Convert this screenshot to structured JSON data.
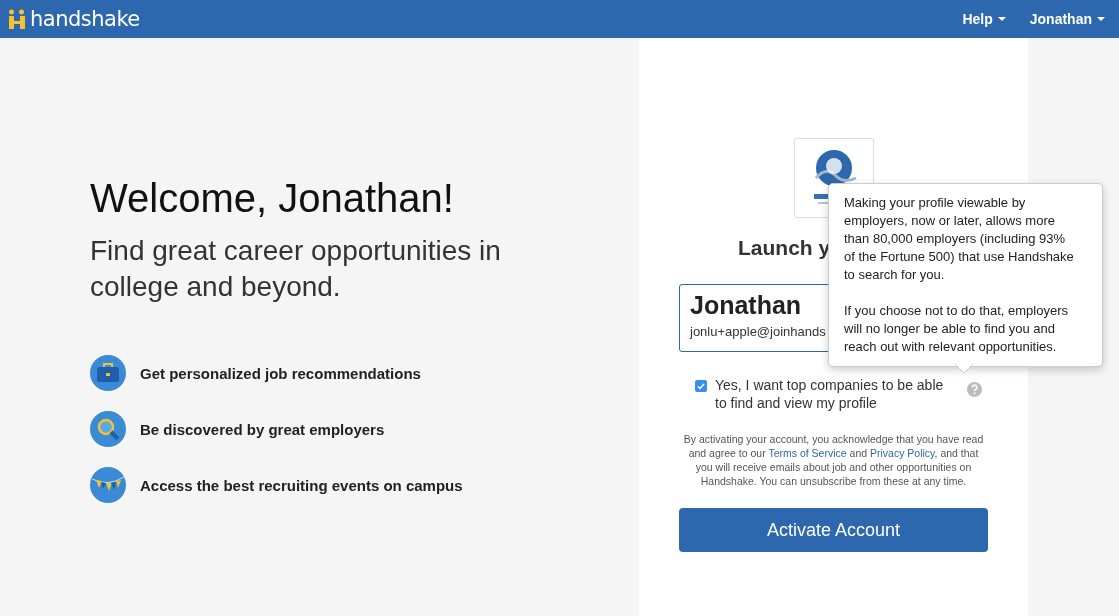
{
  "navbar": {
    "brand": "handshake",
    "menus": [
      {
        "label": "Help"
      },
      {
        "label": "Jonathan"
      }
    ]
  },
  "welcome": {
    "title": "Welcome, Jonathan!",
    "subtitle": "Find great career opportunities in college and beyond.",
    "features": [
      {
        "kind": "briefcase",
        "label": "Get personalized job recommendations"
      },
      {
        "kind": "search",
        "label": "Be discovered by great employers"
      },
      {
        "kind": "flags",
        "label": "Access the best recruiting events on campus"
      }
    ]
  },
  "card": {
    "heading": "Launch y",
    "name": "Jonathan",
    "email": "jonlu+apple@joinhands",
    "consent": {
      "label": "Yes, I want top companies to be able to find and view my profile",
      "checked": true
    },
    "legal": {
      "before": "By activating your account, you acknowledge that you have read and agree to our ",
      "terms": "Terms of Service",
      "middle": " and ",
      "privacy": "Privacy Policy",
      "after": ", and that you will receive emails about job and other opportunities on Handshake. You can unsubscribe from these at any time."
    },
    "button": "Activate Account"
  },
  "popover": {
    "paragraphs": [
      "Making your profile viewable by employers, now or later, allows more than 80,000 employers (including 93% of the Fortune 500) that use Handshake to search for you.",
      "If you choose not to do that, employers will no longer be able to find you and reach out with relevant opportunities."
    ]
  }
}
